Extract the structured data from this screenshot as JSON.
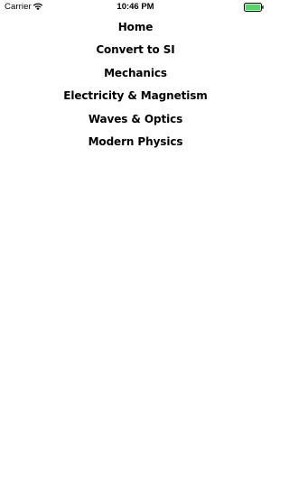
{
  "status_bar": {
    "carrier": "Carrier",
    "time": "10:46 PM",
    "wifi_icon": "wifi-icon",
    "battery_icon": "battery-icon",
    "battery_level": 1.0,
    "battery_color": "#4cd964"
  },
  "menu": {
    "items": [
      {
        "label": "Home"
      },
      {
        "label": "Convert to SI"
      },
      {
        "label": "Mechanics"
      },
      {
        "label": "Electricity & Magnetism"
      },
      {
        "label": "Waves & Optics"
      },
      {
        "label": "Modern Physics"
      }
    ]
  }
}
